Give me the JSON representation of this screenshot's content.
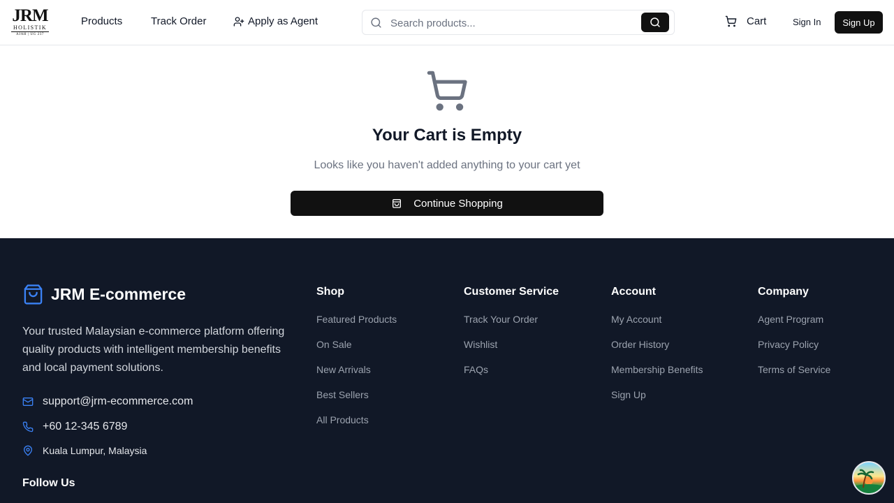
{
  "header": {
    "logo": {
      "mark": "JRM",
      "name": "HOLISTIK",
      "sub": "AJAH | UG 237"
    },
    "nav": {
      "products": "Products",
      "track_order": "Track Order",
      "apply_agent": "Apply as Agent"
    },
    "search": {
      "placeholder": "Search products..."
    },
    "cart": "Cart",
    "sign_in": "Sign In",
    "sign_up": "Sign Up"
  },
  "empty_cart": {
    "title": "Your Cart is Empty",
    "message": "Looks like you haven't added anything to your cart yet",
    "button": "Continue Shopping"
  },
  "footer": {
    "brand": "JRM E-commerce",
    "tagline": "Your trusted Malaysian e-commerce platform offering quality products with intelligent membership benefits and local payment solutions.",
    "email": "support@jrm-ecommerce.com",
    "phone": "+60 12-345 6789",
    "location": "Kuala Lumpur, Malaysia",
    "follow": "Follow Us",
    "columns": [
      {
        "title": "Shop",
        "links": [
          "Featured Products",
          "On Sale",
          "New Arrivals",
          "Best Sellers",
          "All Products"
        ]
      },
      {
        "title": "Customer Service",
        "links": [
          "Track Your Order",
          "Wishlist",
          "FAQs"
        ]
      },
      {
        "title": "Account",
        "links": [
          "My Account",
          "Order History",
          "Membership Benefits",
          "Sign Up"
        ]
      },
      {
        "title": "Company",
        "links": [
          "Agent Program",
          "Privacy Policy",
          "Terms of Service"
        ]
      }
    ]
  },
  "colors": {
    "primary": "#111111",
    "footer_bg": "#111827",
    "accent_blue": "#3b82f6",
    "muted": "#6b7280"
  },
  "icons": [
    "search-icon",
    "user-plus-icon",
    "cart-icon",
    "shopping-bag-icon",
    "mail-icon",
    "phone-icon",
    "map-pin-icon"
  ]
}
